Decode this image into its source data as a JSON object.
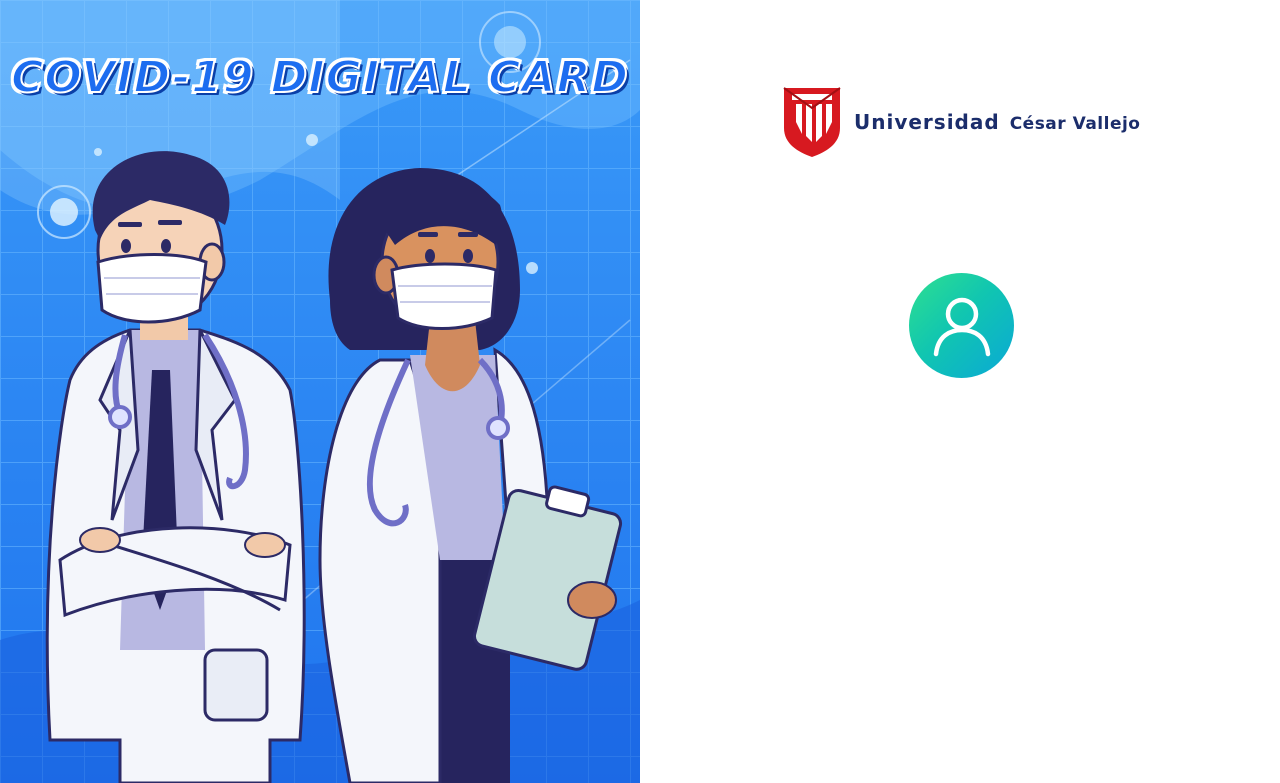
{
  "card": {
    "title": "COVID-19 DIGITAL CARD"
  },
  "brand": {
    "word1": "Universidad",
    "word2": "César Vallejo",
    "logo_color": "#d71920",
    "text_color": "#1b2d6b"
  },
  "user": {
    "avatar_icon": "user-icon",
    "avatar_gradient": [
      "#2fe08f",
      "#0aa8d6"
    ]
  },
  "theme": {
    "hero_background": "#2f8cf5",
    "title_color": "#1d6df0"
  }
}
